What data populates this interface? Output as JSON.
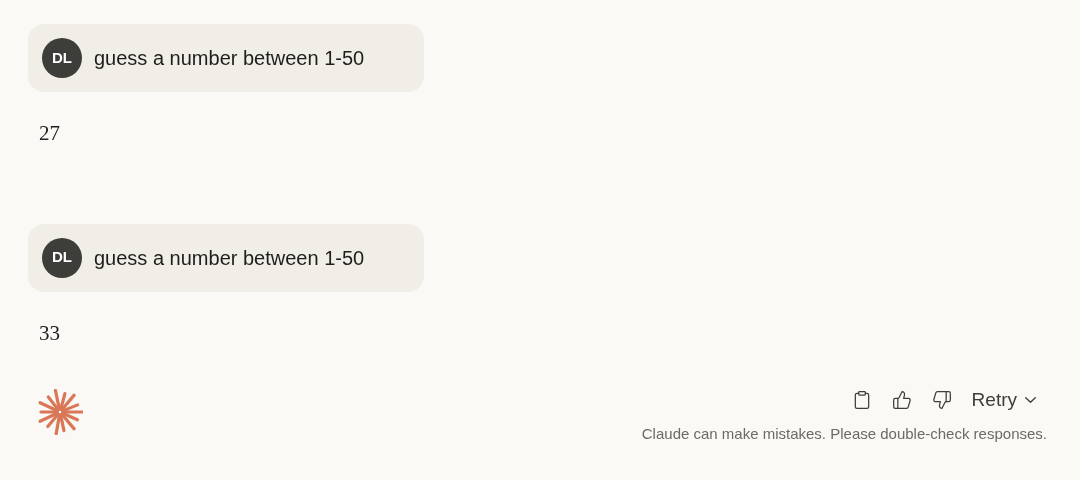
{
  "messages": [
    {
      "user": {
        "avatar": "DL",
        "text": "guess a number between 1-50"
      },
      "reply": "27"
    },
    {
      "user": {
        "avatar": "DL",
        "text": "guess a number between 1-50"
      },
      "reply": "33"
    }
  ],
  "actions": {
    "retry": "Retry"
  },
  "disclaimer": "Claude can make mistakes. Please double-check responses."
}
